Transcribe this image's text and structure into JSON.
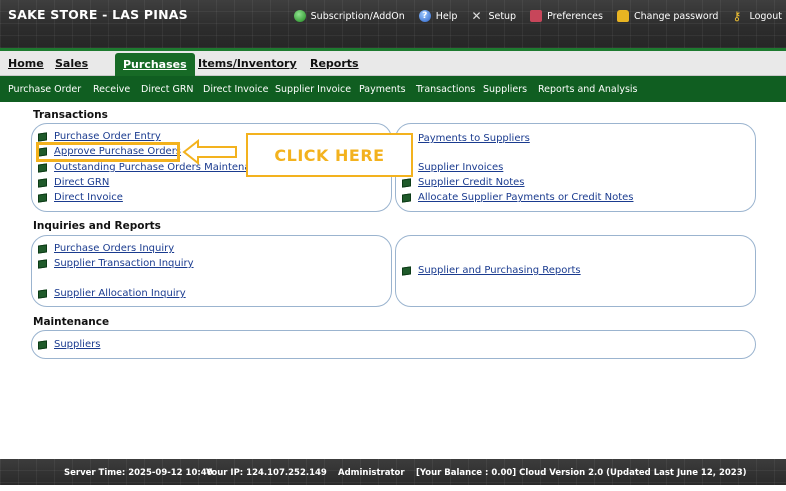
{
  "header": {
    "store_title": "SAKE STORE - LAS PINAS",
    "links": {
      "subscription": "Subscription/AddOn",
      "help": "Help",
      "setup": "Setup",
      "preferences": "Preferences",
      "change_password": "Change password",
      "logout": "Logout"
    }
  },
  "main_nav": {
    "home": "Home",
    "sales": "Sales",
    "purchases": "Purchases",
    "items_inventory": "Items/Inventory",
    "reports": "Reports",
    "active": "Purchases"
  },
  "sub_nav": {
    "purchase_order": "Purchase Order",
    "receive": "Receive",
    "direct_grn": "Direct GRN",
    "direct_invoice": "Direct Invoice",
    "supplier_invoice": "Supplier Invoice",
    "payments": "Payments",
    "transactions": "Transactions",
    "suppliers": "Suppliers",
    "reports_analysis": "Reports and Analysis"
  },
  "transactions": {
    "title": "Transactions",
    "left": [
      "Purchase Order Entry",
      "Approve Purchase Orders",
      "Outstanding Purchase Orders Maintenance",
      "Direct GRN",
      "Direct Invoice"
    ],
    "right": [
      "Payments to Suppliers",
      "Supplier Invoices",
      "Supplier Credit Notes",
      "Allocate Supplier Payments or Credit Notes"
    ]
  },
  "inquiries": {
    "title": "Inquiries and Reports",
    "left": [
      "Purchase Orders Inquiry",
      "Supplier Transaction Inquiry",
      "Supplier Allocation Inquiry"
    ],
    "right": [
      "Supplier and Purchasing Reports"
    ]
  },
  "maintenance": {
    "title": "Maintenance",
    "items": [
      "Suppliers"
    ]
  },
  "callout": {
    "text": "CLICK HERE",
    "color": "#f3b21e"
  },
  "footer": {
    "server_time": "Server Time: 2025-09-12 10:40",
    "ip": "Your IP: 124.107.252.149",
    "user": "Administrator",
    "balance": "[Your Balance : 0.00] Cloud Version 2.0 (Updated Last June 12, 2023)"
  },
  "colors": {
    "primary_green": "#176a26",
    "sub_nav_green": "#105e21",
    "link_blue": "#1a3b8f",
    "panel_border": "#9bb4cf"
  }
}
